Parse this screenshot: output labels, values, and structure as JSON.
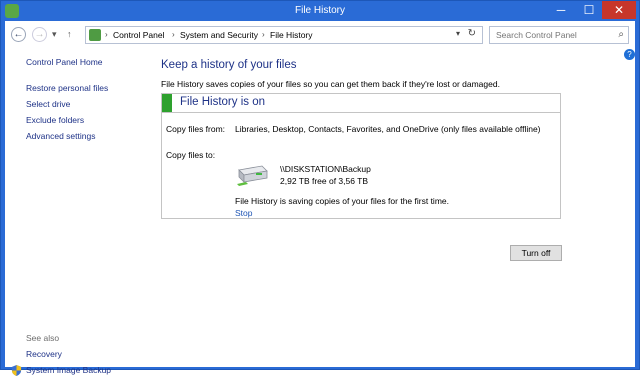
{
  "window": {
    "title": "File History",
    "controls": {
      "minimize": "─",
      "maximize": "☐",
      "close": "✕"
    }
  },
  "address": {
    "back": "←",
    "forward": "→",
    "recent": "▾",
    "up": "↑",
    "separator": "›",
    "crumbs": [
      "Control Panel",
      "System and Security",
      "File History"
    ],
    "dropdown": "▾",
    "refresh": "↻"
  },
  "search": {
    "placeholder": "Search Control Panel",
    "icon": "⌕"
  },
  "help": "?",
  "sidebar": {
    "home": "Control Panel Home",
    "items": [
      "Restore personal files",
      "Select drive",
      "Exclude folders",
      "Advanced settings"
    ],
    "see_also_label": "See also",
    "see_also": [
      "Recovery",
      "System Image Backup"
    ]
  },
  "main": {
    "heading": "Keep a history of your files",
    "description": "File History saves copies of your files so you can get them back if they're lost or damaged.",
    "status_title": "File History is on",
    "copy_from_label": "Copy files from:",
    "copy_from_value": "Libraries, Desktop, Contacts, Favorites, and OneDrive (only files available offline)",
    "copy_to_label": "Copy files to:",
    "drive_path": "\\\\DISKSTATION\\Backup",
    "drive_free": "2,92 TB free of 3,56 TB",
    "saving_message": "File History is saving copies of your files for the first time.",
    "stop_link": "Stop",
    "turn_off_button": "Turn off"
  },
  "colors": {
    "accent": "#2a6bd6",
    "link": "#1e3287",
    "status_green": "#2ea12e"
  }
}
